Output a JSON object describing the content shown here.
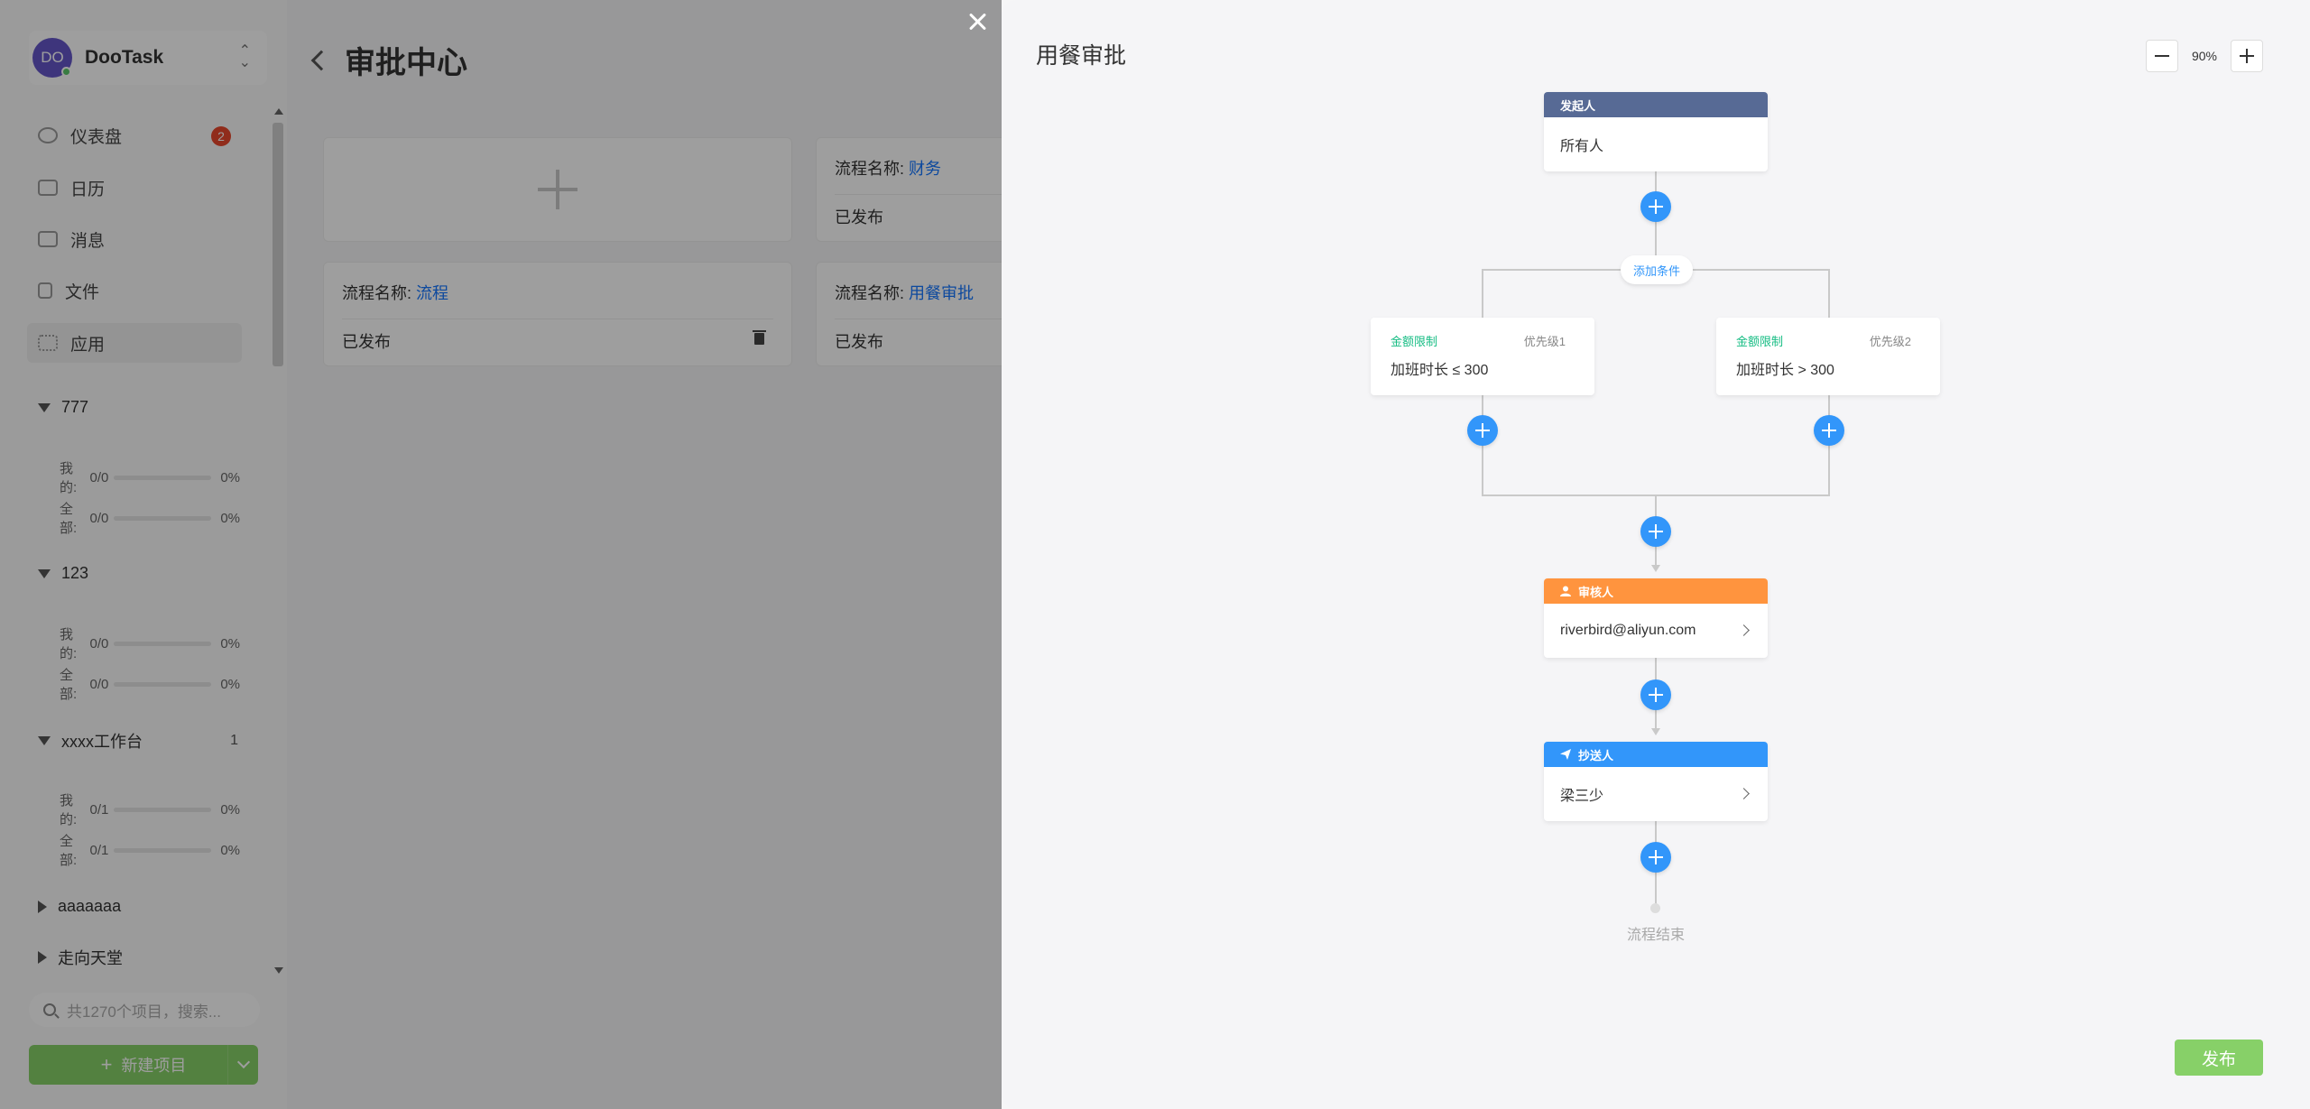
{
  "sidebar": {
    "avatar_initials": "DO",
    "team_name": "DooTask",
    "nav": [
      {
        "label": "仪表盘",
        "badge": "2"
      },
      {
        "label": "日历"
      },
      {
        "label": "消息"
      },
      {
        "label": "文件"
      },
      {
        "label": "应用"
      }
    ],
    "projects": [
      {
        "name": "777",
        "mine_label": "我的:",
        "mine": "0/0",
        "mine_pct": "0%",
        "all_label": "全部:",
        "all": "0/0",
        "all_pct": "0%",
        "count": ""
      },
      {
        "name": "123",
        "mine_label": "我的:",
        "mine": "0/0",
        "mine_pct": "0%",
        "all_label": "全部:",
        "all": "0/0",
        "all_pct": "0%",
        "count": ""
      },
      {
        "name": "xxxx工作台",
        "mine_label": "我的:",
        "mine": "0/1",
        "mine_pct": "0%",
        "all_label": "全部:",
        "all": "0/1",
        "all_pct": "0%",
        "count": "1"
      },
      {
        "name": "aaaaaaa"
      },
      {
        "name": "走向天堂"
      }
    ],
    "search_placeholder": "共1270个项目，搜索...",
    "new_project_label": "新建项目"
  },
  "main": {
    "title": "审批中心",
    "workflows": [
      {
        "name_label": "流程名称:",
        "name": "财务",
        "status": "已发布"
      },
      {
        "name_label": "流程名称:",
        "name": "流程",
        "status": "已发布"
      },
      {
        "name_label": "流程名称:",
        "name": "用餐审批",
        "status": "已发布"
      }
    ]
  },
  "drawer": {
    "title": "用餐审批",
    "zoom": "90%",
    "initiator": {
      "header": "发起人",
      "body": "所有人"
    },
    "add_condition": "添加条件",
    "conditions": [
      {
        "title": "金额限制",
        "priority": "优先级1",
        "text": "加班时长 ≤ 300"
      },
      {
        "title": "金额限制",
        "priority": "优先级2",
        "text": "加班时长 > 300"
      }
    ],
    "approver": {
      "header": "审核人",
      "body": "riverbird@aliyun.com"
    },
    "cc": {
      "header": "抄送人",
      "body": "梁三少"
    },
    "end_label": "流程结束",
    "publish_label": "发布"
  },
  "colors": {
    "initiator_header": "#576a95",
    "approver_header": "#ff943e",
    "cc_header": "#3296fa",
    "plus_button": "#3296fa",
    "condition_title": "#15bc83",
    "publish": "#87d068",
    "badge": "#e8482c"
  },
  "icons": {
    "approver": "user-icon",
    "cc": "send-icon",
    "close": "close-icon",
    "back": "chevron-left-icon"
  }
}
